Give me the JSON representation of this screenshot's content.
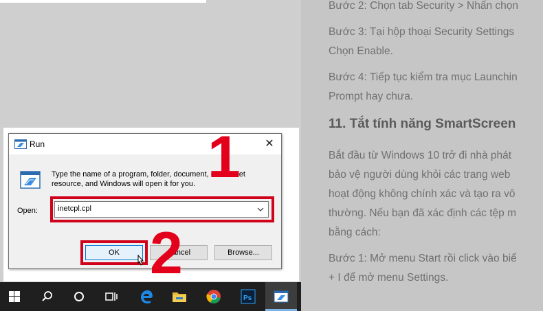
{
  "article": {
    "lines": [
      "Bước 2: Chọn tab Security > Nhấn chọn",
      "Bước 3: Tại hộp thoại Security Settings",
      "Chọn Enable.",
      "Bước 4: Tiếp tục kiểm tra mục Launchin",
      "Prompt hay chưa.",
      "11. Tắt tính năng SmartScreen",
      "Bắt đầu từ Windows 10 trở đi nhà phát",
      "bảo vệ người dùng khỏi các trang web",
      "hoạt động không chính xác và tạo ra vô",
      "thường. Nếu bạn đã xác định các tệp m",
      "bằng cách:",
      "Bước 1: Mở menu Start rồi click vào biể",
      "+ I để mở menu Settings."
    ]
  },
  "dialog": {
    "title": "Run",
    "description": "Type the name of a program, folder, document, or Internet resource, and Windows will open it for you.",
    "open_label": "Open:",
    "open_value": "inetcpl.cpl",
    "ok_label": "OK",
    "cancel_label": "Cancel",
    "browse_label": "Browse...",
    "close_label": "✕"
  },
  "annotations": {
    "step1": "1",
    "step2": "2",
    "highlight_color": "#d0021b"
  },
  "taskbar": {
    "icons": [
      "windows-start-icon",
      "search-icon",
      "cortana-icon",
      "task-view-icon",
      "edge-icon",
      "file-explorer-icon",
      "chrome-icon",
      "photoshop-icon",
      "run-app-icon"
    ]
  },
  "colors": {
    "accent": "#0078d7",
    "red": "#e3001b",
    "taskbar": "#1f1f1f"
  }
}
